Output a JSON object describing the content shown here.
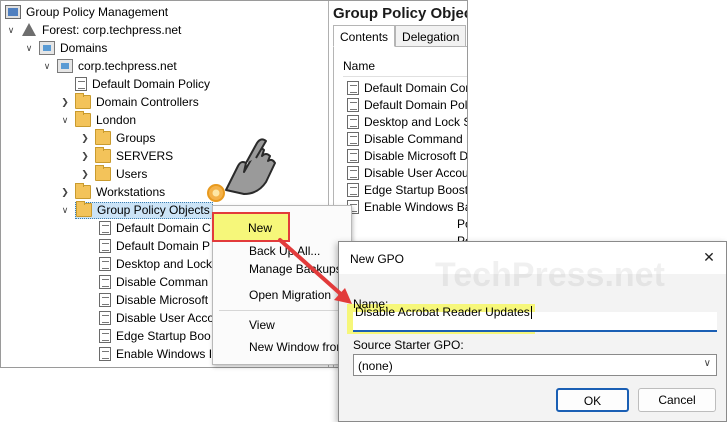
{
  "tree": {
    "root": "Group Policy Management",
    "forest": "Forest: corp.techpress.net",
    "domains": "Domains",
    "domain": "corp.techpress.net",
    "items": [
      {
        "label": "Default Domain Policy",
        "icon": "gpo-link-icon"
      },
      {
        "label": "Domain Controllers",
        "icon": "folder-icon"
      },
      {
        "label": "London",
        "icon": "folder-icon"
      },
      {
        "label": "Groups",
        "icon": "folder-icon"
      },
      {
        "label": "SERVERS",
        "icon": "folder-icon"
      },
      {
        "label": "Users",
        "icon": "folder-icon"
      },
      {
        "label": "Workstations",
        "icon": "folder-icon"
      },
      {
        "label": "Group Policy Objects",
        "icon": "folder-icon"
      }
    ],
    "gpos": [
      "Default Domain C",
      "Default Domain P",
      "Desktop and Lock",
      "Disable Comman",
      "Disable Microsoft",
      "Disable User Acco",
      "Edge Startup Boo",
      "Enable Windows I"
    ]
  },
  "right_panel": {
    "title": "Group Policy Objects",
    "tabs": [
      "Contents",
      "Delegation"
    ],
    "active_tab": "Contents",
    "column_header": "Name",
    "rows": [
      "Default Domain Contro",
      "Default Domain Policy",
      "Desktop and Lock Sc",
      "Disable Command Pro",
      "Disable Microsoft Defe",
      "Disable User Account",
      "Edge Startup Boost",
      "Enable Windows Back"
    ],
    "partial_rows": [
      "Po",
      "Pol"
    ]
  },
  "context_menu": {
    "items": [
      "New",
      "Back Up All...",
      "Manage Backups",
      "Open Migration",
      "View",
      "New Window from"
    ]
  },
  "dialog": {
    "title": "New GPO",
    "watermark": "TechPress.net",
    "name_label": "Name:",
    "name_value": "Disable Acrobat Reader Updates",
    "starter_label": "Source Starter GPO:",
    "starter_value": "(none)",
    "ok_label": "OK",
    "cancel_label": "Cancel"
  },
  "colors": {
    "highlight": "#f6f77a",
    "callout_red": "#e23b3b",
    "selection": "#cce4f7",
    "focus_blue": "#1a5fb4"
  }
}
